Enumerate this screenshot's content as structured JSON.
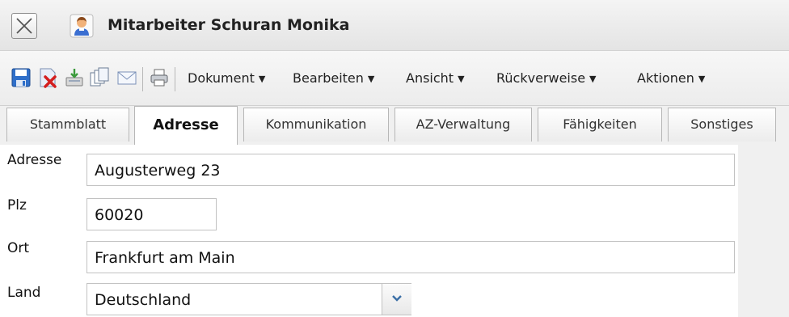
{
  "window": {
    "title": "Mitarbeiter Schuran Monika",
    "icons": {
      "close": "close-icon",
      "person": "person-icon"
    }
  },
  "toolbar": {
    "icons": [
      "save-icon",
      "delete-icon",
      "export-icon",
      "copy-icon",
      "mail-icon",
      "print-icon"
    ],
    "menus": [
      {
        "label": "Dokument"
      },
      {
        "label": "Bearbeiten"
      },
      {
        "label": "Ansicht"
      },
      {
        "label": "Rückverweise"
      },
      {
        "label": "Aktionen"
      }
    ]
  },
  "tabs": [
    {
      "label": "Stammblatt",
      "active": false
    },
    {
      "label": "Adresse",
      "active": true
    },
    {
      "label": "Kommunikation",
      "active": false
    },
    {
      "label": "AZ-Verwaltung",
      "active": false
    },
    {
      "label": "Fähigkeiten",
      "active": false
    },
    {
      "label": "Sonstiges",
      "active": false
    }
  ],
  "form": {
    "adresse": {
      "label": "Adresse",
      "value": "Augusterweg 23"
    },
    "plz": {
      "label": "Plz",
      "value": "60020"
    },
    "ort": {
      "label": "Ort",
      "value": "Frankfurt am Main"
    },
    "land": {
      "label": "Land",
      "value": "Deutschland"
    }
  },
  "colors": {
    "titlebar": "#e9e9e9",
    "toolbar": "#efefef",
    "tabstrip": "#f0f0f0",
    "field_border": "#c2c2c2",
    "select_arrow": "#3a6ea5"
  }
}
